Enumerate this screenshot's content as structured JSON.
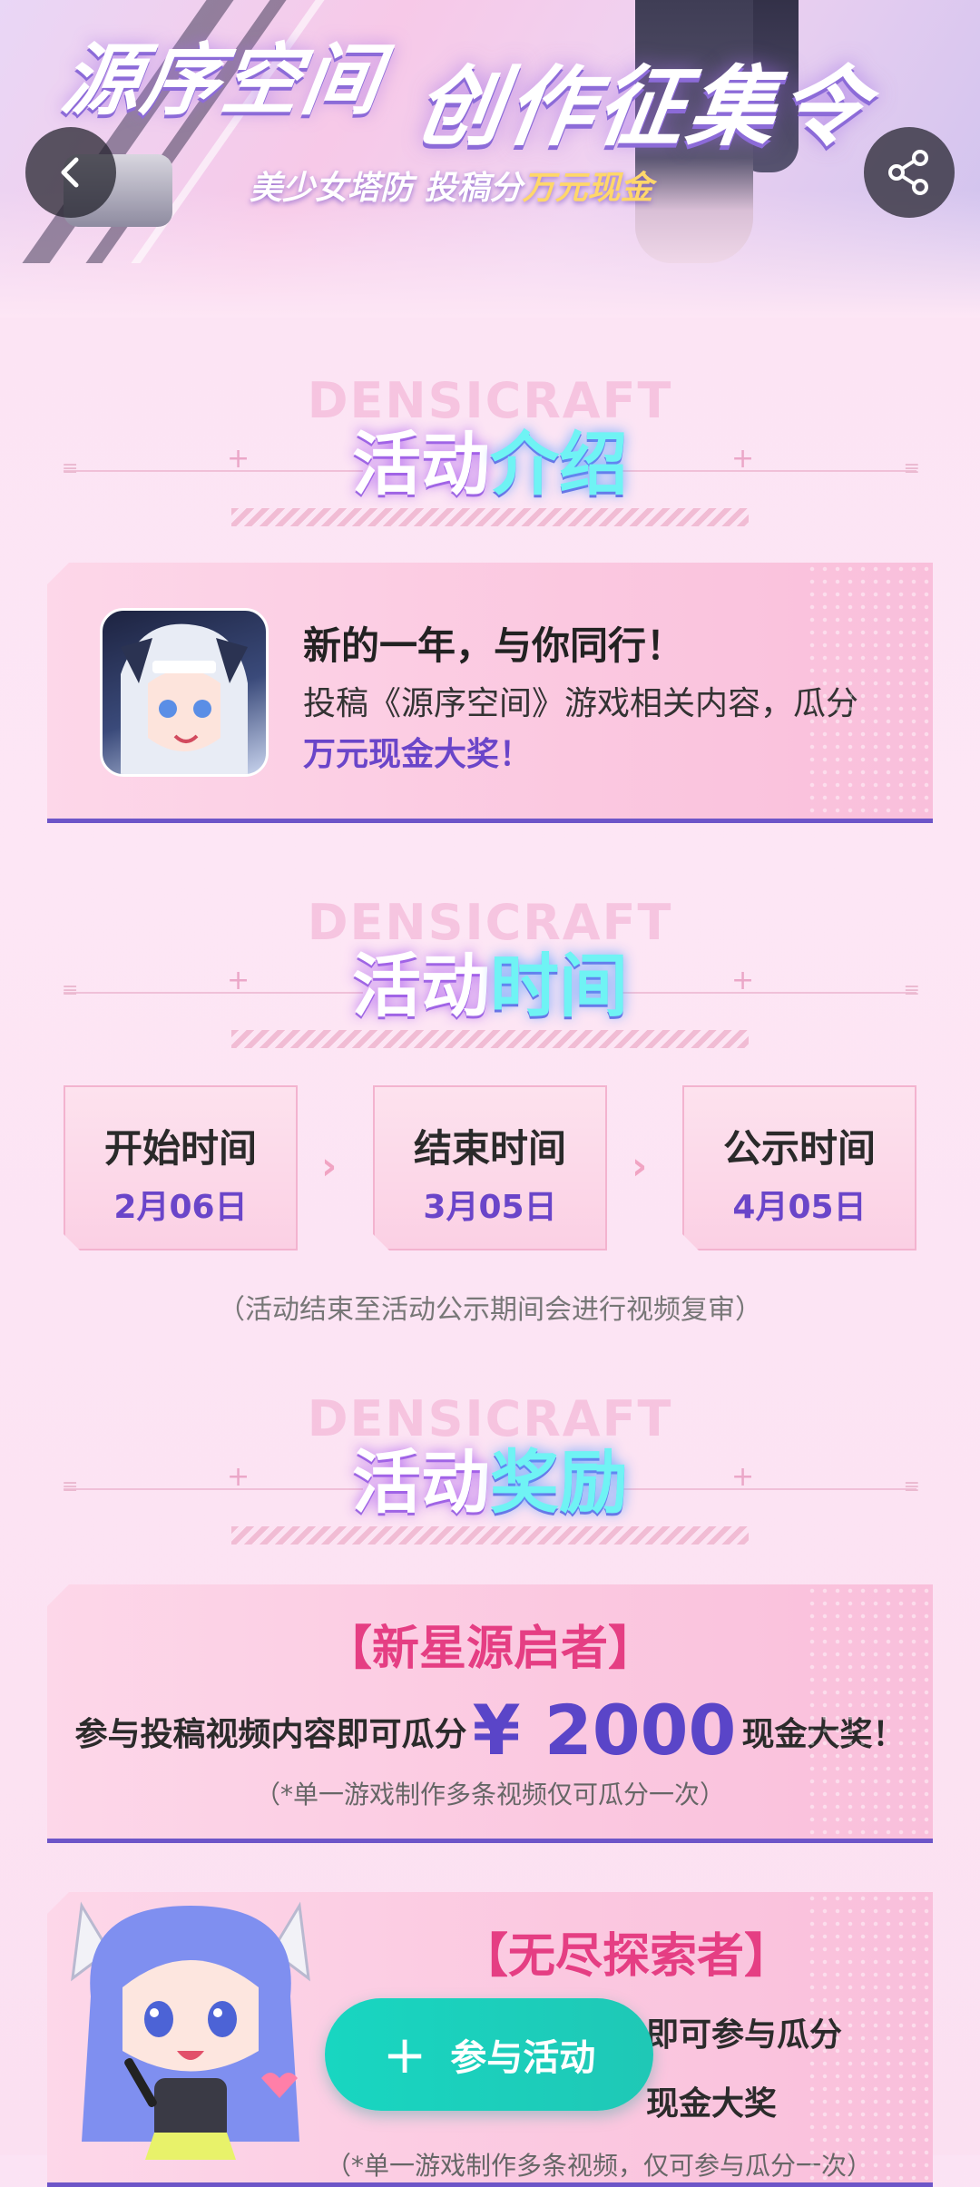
{
  "hero": {
    "title_left": "源序空间",
    "title_right": "创作征集令",
    "subtitle_prefix": "美少女塔防 投稿分",
    "subtitle_highlight": "万元现金"
  },
  "sections": {
    "intro": {
      "watermark": "DENSICRAFT",
      "title_a": "活动",
      "title_b": "介绍"
    },
    "time": {
      "watermark": "DENSICRAFT",
      "title_a": "活动",
      "title_b": "时间"
    },
    "reward": {
      "watermark": "DENSICRAFT",
      "title_a": "活动",
      "title_b": "奖励"
    }
  },
  "intro_card": {
    "heading": "新的一年，与你同行！",
    "body": "投稿《源序空间》游戏相关内容，瓜分",
    "highlight": "万元现金大奖！"
  },
  "timeline": [
    {
      "label": "开始时间",
      "date": "2月06日"
    },
    {
      "label": "结束时间",
      "date": "3月05日"
    },
    {
      "label": "公示时间",
      "date": "4月05日"
    }
  ],
  "time_note": "（活动结束至活动公示期间会进行视频复审）",
  "rewards": [
    {
      "title": "【新星源启者】",
      "line_prefix": "参与投稿视频内容即可瓜分",
      "amount": "¥ 2000",
      "line_suffix": "现金大奖！",
      "note": "（*单一游戏制作多条视频仅可瓜分一次）"
    },
    {
      "title": "【无尽探索者】",
      "line1_suffix": "即可参与瓜分",
      "line2_suffix": "现金大奖",
      "note": "（*单一游戏制作多条视频，仅可参与瓜分一次）"
    }
  ],
  "fab": {
    "label": "参与活动"
  },
  "colors": {
    "accent_purple": "#6a45c9",
    "accent_pink": "#e53e83",
    "fab_teal": "#18d6c1",
    "card_border": "#6d55c8"
  },
  "icons": {
    "back": "chevron-left-icon",
    "share": "share-icon",
    "next": "chevron-right-icon",
    "add": "plus-icon"
  }
}
